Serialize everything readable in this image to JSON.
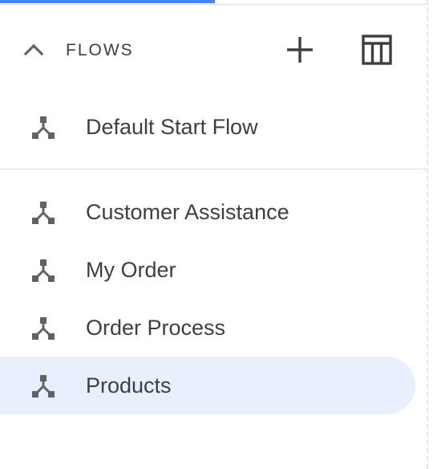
{
  "section": {
    "title": "FLOWS",
    "collapse_icon": "chevron-up-icon",
    "add_icon": "plus-icon",
    "table_icon": "table-view-icon"
  },
  "start_flow": {
    "label": "Default Start Flow",
    "icon": "flow-icon"
  },
  "flows": [
    {
      "label": "Customer Assistance",
      "icon": "flow-icon",
      "selected": false
    },
    {
      "label": "My Order",
      "icon": "flow-icon",
      "selected": false
    },
    {
      "label": "Order Process",
      "icon": "flow-icon",
      "selected": false
    },
    {
      "label": "Products",
      "icon": "flow-icon",
      "selected": true
    }
  ],
  "colors": {
    "accent": "#4285f4",
    "selected_bg": "#e8f0fe",
    "text": "#3c4043",
    "icon": "#5f6368",
    "divider": "#dadce0"
  }
}
